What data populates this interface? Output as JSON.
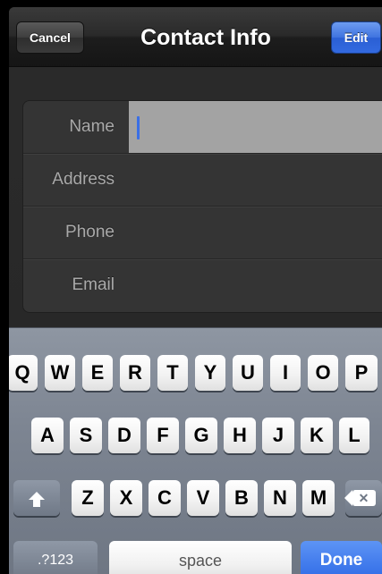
{
  "navbar": {
    "cancel_label": "Cancel",
    "title": "Contact Info",
    "edit_label": "Edit"
  },
  "form": {
    "fields": [
      {
        "label": "Name",
        "value": "",
        "placeholder": ""
      },
      {
        "label": "Address",
        "value": "",
        "placeholder": ""
      },
      {
        "label": "Phone",
        "value": "",
        "placeholder": ""
      },
      {
        "label": "Email",
        "value": "",
        "placeholder": ""
      }
    ]
  },
  "keyboard": {
    "row1": [
      "Q",
      "W",
      "E",
      "R",
      "T",
      "Y",
      "U",
      "I",
      "O",
      "P"
    ],
    "row2": [
      "A",
      "S",
      "D",
      "F",
      "G",
      "H",
      "J",
      "K",
      "L"
    ],
    "row3": [
      "Z",
      "X",
      "C",
      "V",
      "B",
      "N",
      "M"
    ],
    "shift_icon": "shift-arrow",
    "backspace_icon": "backspace-x",
    "numbers_label": ".?123",
    "space_label": "space",
    "done_label": "Done"
  },
  "colors": {
    "accent": "#336ae0",
    "field_highlight": "#a3a3a3"
  }
}
